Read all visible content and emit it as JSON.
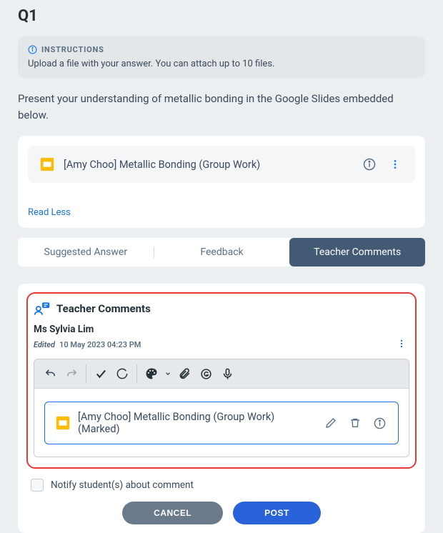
{
  "question": {
    "number": "Q1"
  },
  "instructions": {
    "label": "INSTRUCTIONS",
    "text": "Upload a file with your answer. You can attach up to 10 files."
  },
  "prompt": "Present your understanding of metallic bonding in the Google Slides embedded below.",
  "attachment": {
    "name": "[Amy Choo] Metallic Bonding (Group Work)"
  },
  "readToggle": "Read Less",
  "tabs": {
    "suggested": "Suggested Answer",
    "feedback": "Feedback",
    "comments": "Teacher Comments"
  },
  "commentsPanel": {
    "title": "Teacher Comments",
    "teacher": "Ms Sylvia Lim",
    "editedLabel": "Edited",
    "timestamp": "10 May 2023 04:23 PM",
    "markedFile": "[Amy Choo] Metallic Bonding (Group Work) (Marked)"
  },
  "notify": {
    "label": "Notify student(s) about comment"
  },
  "buttons": {
    "cancel": "CANCEL",
    "post": "POST"
  }
}
